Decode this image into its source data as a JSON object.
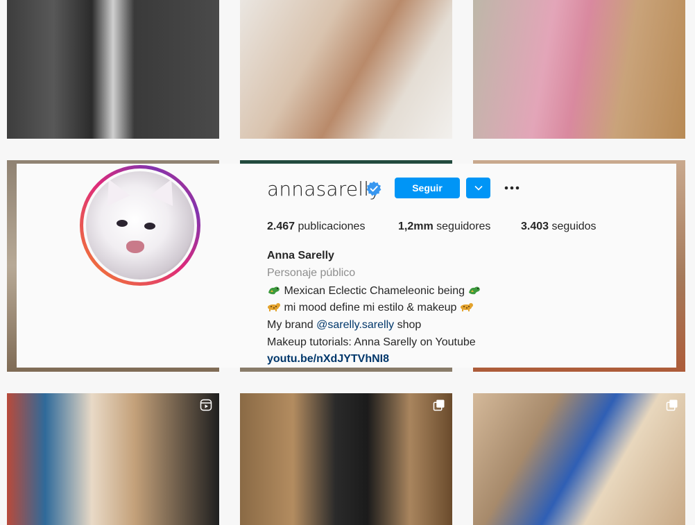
{
  "profile": {
    "username": "annasarelly",
    "verified": true,
    "follow_label": "Seguir",
    "stats": {
      "posts_count": "2.467",
      "posts_label": "publicaciones",
      "followers_count": "1,2mm",
      "followers_label": "seguidores",
      "following_count": "3.403",
      "following_label": "seguidos"
    },
    "full_name": "Anna Sarelly",
    "category": "Personaje público",
    "bio": {
      "line1_text": "Mexican Eclectic Chameleonic being",
      "line2_text": "mi mood define mi estilo & makeup",
      "line3_prefix": "My brand",
      "line3_mention": "@sarelly.sarelly",
      "line3_suffix": "shop",
      "line4_text": "Makeup tutorials: Anna Sarelly on Youtube"
    },
    "link": "youtu.be/nXdJYTVhNI8"
  },
  "grid": {
    "indicators": {
      "b1": "reel-icon",
      "b2": "carousel-icon",
      "b3": "carousel-icon"
    }
  },
  "colors": {
    "accent": "#0095f6",
    "link": "#00376b",
    "text": "#262626",
    "secondary": "#8e8e8e",
    "verified_badge": "#3897f0"
  }
}
